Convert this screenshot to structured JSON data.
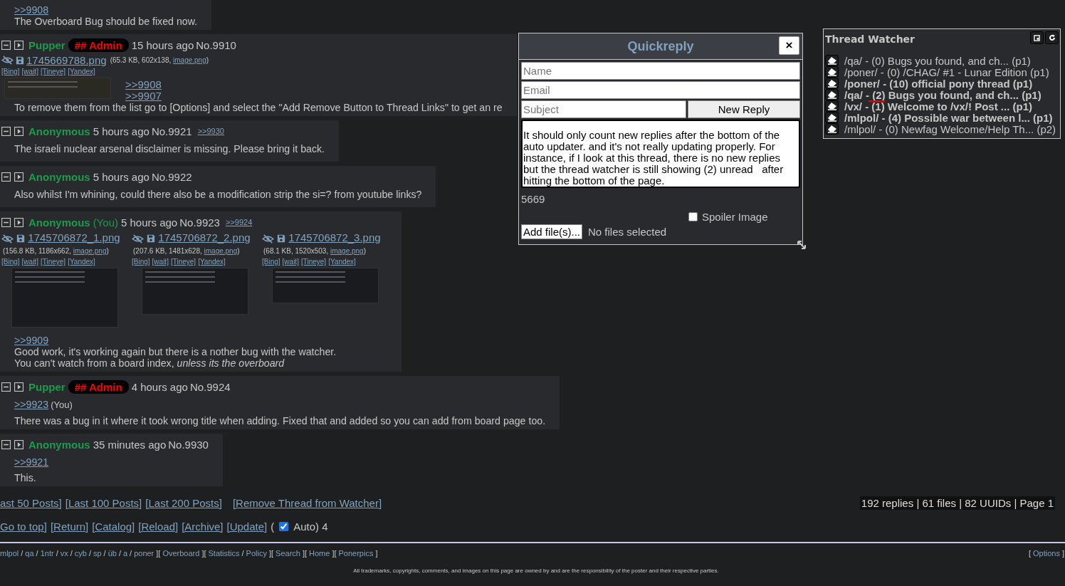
{
  "posts": [
    {
      "quotes": [
        {
          "text": ">>9908"
        }
      ],
      "body": [
        "The Overboard Bug should be fixed now."
      ]
    },
    {
      "header": {
        "name": "Pupper",
        "capcode": "## Admin",
        "time": "15 hours ago",
        "number": "No.9910"
      },
      "files": [
        {
          "name": "1745669788.png",
          "info": "(65.3 KB, 602x138, ",
          "link": "image.png",
          "close": ")",
          "search": [
            "[Bing]",
            "[wait]",
            "[Tineye]",
            "[Yandex]"
          ]
        }
      ],
      "quotes": [
        {
          "text": ">>9908"
        },
        {
          "text": ">>9907"
        }
      ],
      "body": [
        "To remove them from the list go to [Options] and select the \"Add Remove Button to Thread Links\" to get an re"
      ]
    },
    {
      "header": {
        "name": "Anonymous",
        "time": "5 hours ago",
        "number": "No.9921",
        "backlinks": [
          ">>9930"
        ]
      },
      "body": [
        "The israeli nuclear arsenal disclaimer is missing. Please bring it back."
      ]
    },
    {
      "header": {
        "name": "Anonymous",
        "time": "5 hours ago",
        "number": "No.9922"
      },
      "body": [
        "Also whilst I'm whining, could there also be a modification strip the si=? from youtube links?"
      ]
    },
    {
      "header": {
        "name": "Anonymous",
        "you": "(You)",
        "time": "5 hours ago",
        "number": "No.9923",
        "backlinks": [
          ">>9924"
        ]
      },
      "files": [
        {
          "name": "1745706872_1.png",
          "info": "(156.8 KB, 1186x662, ",
          "link": "image.png",
          "close": ")",
          "search": [
            "[Bing]",
            "[wait]",
            "[Tineye]",
            "[Yandex]"
          ]
        },
        {
          "name": "1745706872_2.png",
          "info": "(207.6 KB, 1481x628, ",
          "link": "image.png",
          "close": ")",
          "search": [
            "[Bing]",
            "[wait]",
            "[Tineye]",
            "[Yandex]"
          ]
        },
        {
          "name": "1745706872_3.png",
          "info": "(68.1 KB, 1520x503, ",
          "link": "image.png",
          "close": ")",
          "search": [
            "[Bing]",
            "[wait]",
            "[Tineye]",
            "[Yandex]"
          ]
        }
      ],
      "quotes": [
        {
          "text": ">>9909"
        }
      ],
      "body": [
        "Good work, it's working again but there is a nother bug with the watcher.",
        "You can't watch from a board index, *unless its the overboard*"
      ]
    },
    {
      "header": {
        "name": "Pupper",
        "capcode": "## Admin",
        "time": "4 hours ago",
        "number": "No.9924"
      },
      "quotes": [
        {
          "text": ">>9923",
          "you": "(You)"
        }
      ],
      "body": [
        "There was a bug in it where it took wrong title when adding. Fixed that and added so you can add from board page too."
      ]
    },
    {
      "header": {
        "name": "Anonymous",
        "time": "35 minutes ago",
        "number": "No.9930"
      },
      "quotes": [
        {
          "text": ">>9921"
        }
      ],
      "body": [
        "This."
      ]
    }
  ],
  "thread_links": [
    "ast 50 Posts]",
    "[Last 100 Posts]",
    "[Last 200 Posts]"
  ],
  "remove_link": "[Remove Thread from Watcher]",
  "stats": "192 replies |  61 files |  82 UUIDs |  Page 1",
  "nav_links": [
    "Go to top]",
    "[Return]",
    "[Catalog]",
    "[Reload]",
    "[Archive]",
    "[Update]"
  ],
  "auto_update": {
    "open": "(",
    "checked": true,
    "label": "Auto) 4"
  },
  "footer_nav": [
    {
      "kind": "link",
      "text": "mlpol"
    },
    {
      "kind": "sep",
      "text": "/"
    },
    {
      "kind": "link",
      "text": "qa"
    },
    {
      "kind": "sep",
      "text": "/"
    },
    {
      "kind": "link",
      "text": "1ntr"
    },
    {
      "kind": "sep",
      "text": "/"
    },
    {
      "kind": "link",
      "text": "vx"
    },
    {
      "kind": "sep",
      "text": "/"
    },
    {
      "kind": "link",
      "text": "cyb"
    },
    {
      "kind": "sep",
      "text": "/"
    },
    {
      "kind": "link",
      "text": "sp"
    },
    {
      "kind": "sep",
      "text": "/"
    },
    {
      "kind": "link",
      "text": "üb"
    },
    {
      "kind": "sep",
      "text": "/"
    },
    {
      "kind": "link",
      "text": "a"
    },
    {
      "kind": "sep",
      "text": "/"
    },
    {
      "kind": "link",
      "text": "poner"
    },
    {
      "kind": "sep",
      "text": "]["
    },
    {
      "kind": "link",
      "text": "Overboard"
    },
    {
      "kind": "sep",
      "text": "]["
    },
    {
      "kind": "link",
      "text": "Statistics"
    },
    {
      "kind": "sep",
      "text": "/"
    },
    {
      "kind": "link",
      "text": "Policy"
    },
    {
      "kind": "sep",
      "text": "]["
    },
    {
      "kind": "link",
      "text": "Search"
    },
    {
      "kind": "sep",
      "text": "]["
    },
    {
      "kind": "link",
      "text": "Home"
    },
    {
      "kind": "sep",
      "text": "]["
    },
    {
      "kind": "link",
      "text": "Ponerpics"
    },
    {
      "kind": "sep",
      "text": "]"
    }
  ],
  "options": {
    "open": "[",
    "link": "Options",
    "close": "]"
  },
  "disclaimer": "All trademarks, copyrights, comments, and images on this page are owned by and are the responsibility of the poster and their respective parties.",
  "quickreply": {
    "title": "Quickreply",
    "close": "×",
    "name_placeholder": "Name",
    "email_placeholder": "Email",
    "subject_placeholder": "Subject",
    "submit": "New Reply",
    "message": "It should only count new replies after the bottom of the auto updater. and it's not really updating properly. For instance, if I look at this thread, there is no new replies but the thread watcher is still showing (2) unread   after hitting the bottom of the page.",
    "counter": "5669",
    "spoiler": {
      "label": "Spoiler Image",
      "checked": false
    },
    "add_file": "Add file(s)...",
    "no_files": "No files selected"
  },
  "thread_watcher": {
    "title": "Thread Watcher",
    "items": [
      {
        "prefix": "/qa/ - ",
        "count": "(0)",
        "rest": " Bugs you found, and ch... (p1)",
        "unread": false,
        "marked": false
      },
      {
        "prefix": "/poner/ - ",
        "count": "(0)",
        "rest": " /CHAG/ #1 - Lunar Edition (p1)",
        "unread": false,
        "marked": false
      },
      {
        "prefix": "/poner/ - ",
        "count": "(10)",
        "rest": " official pony thread (p1)",
        "unread": true,
        "marked": false
      },
      {
        "prefix": "/qa/ - ",
        "count": "(2)",
        "rest": " Bugs you found, and ch... (p1)",
        "unread": true,
        "marked": true
      },
      {
        "prefix": "/vx/ - ",
        "count": "(1)",
        "rest": " Welcome to /vx/! Post ... (p1)",
        "unread": true,
        "marked": false
      },
      {
        "prefix": "/mlpol/ - ",
        "count": "(4)",
        "rest": " Possible war between l... (p1)",
        "unread": true,
        "marked": false
      },
      {
        "prefix": "/mlpol/ - ",
        "count": "(0)",
        "rest": " Newfag Welcome/Help Th... (p2)",
        "unread": false,
        "marked": false
      }
    ]
  }
}
